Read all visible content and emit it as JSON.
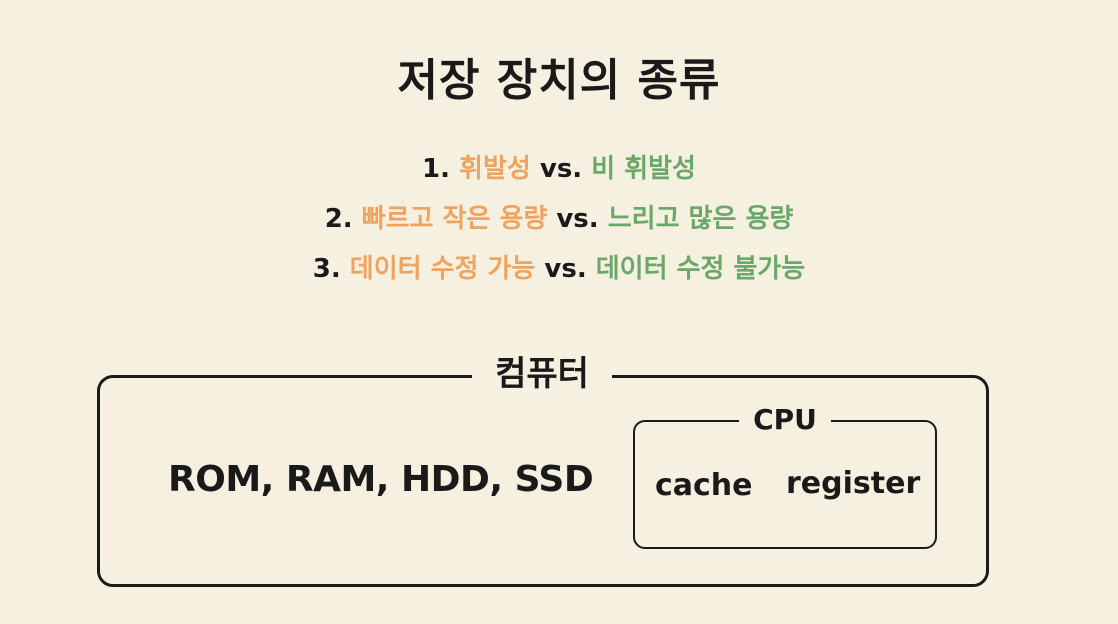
{
  "title": "저장 장치의 종류",
  "colors": {
    "volatile": "#f0a35f",
    "nonvolatile": "#6aa86a",
    "text": "#1a1a1a",
    "background": "#f6f0e0"
  },
  "comparisons": [
    {
      "number": "1.",
      "left": "휘발성",
      "vs": "vs.",
      "right": "비 휘발성"
    },
    {
      "number": "2.",
      "left": "빠르고 작은 용량",
      "vs": "vs.",
      "right": "느리고 많은 용량"
    },
    {
      "number": "3.",
      "left": "데이터 수정 가능",
      "vs": "vs.",
      "right": "데이터 수정 불가능"
    }
  ],
  "computer": {
    "label": "컴퓨터",
    "devices": "ROM, RAM, HDD, SSD",
    "cpu": {
      "label": "CPU",
      "items": [
        "cache",
        "register"
      ]
    }
  }
}
